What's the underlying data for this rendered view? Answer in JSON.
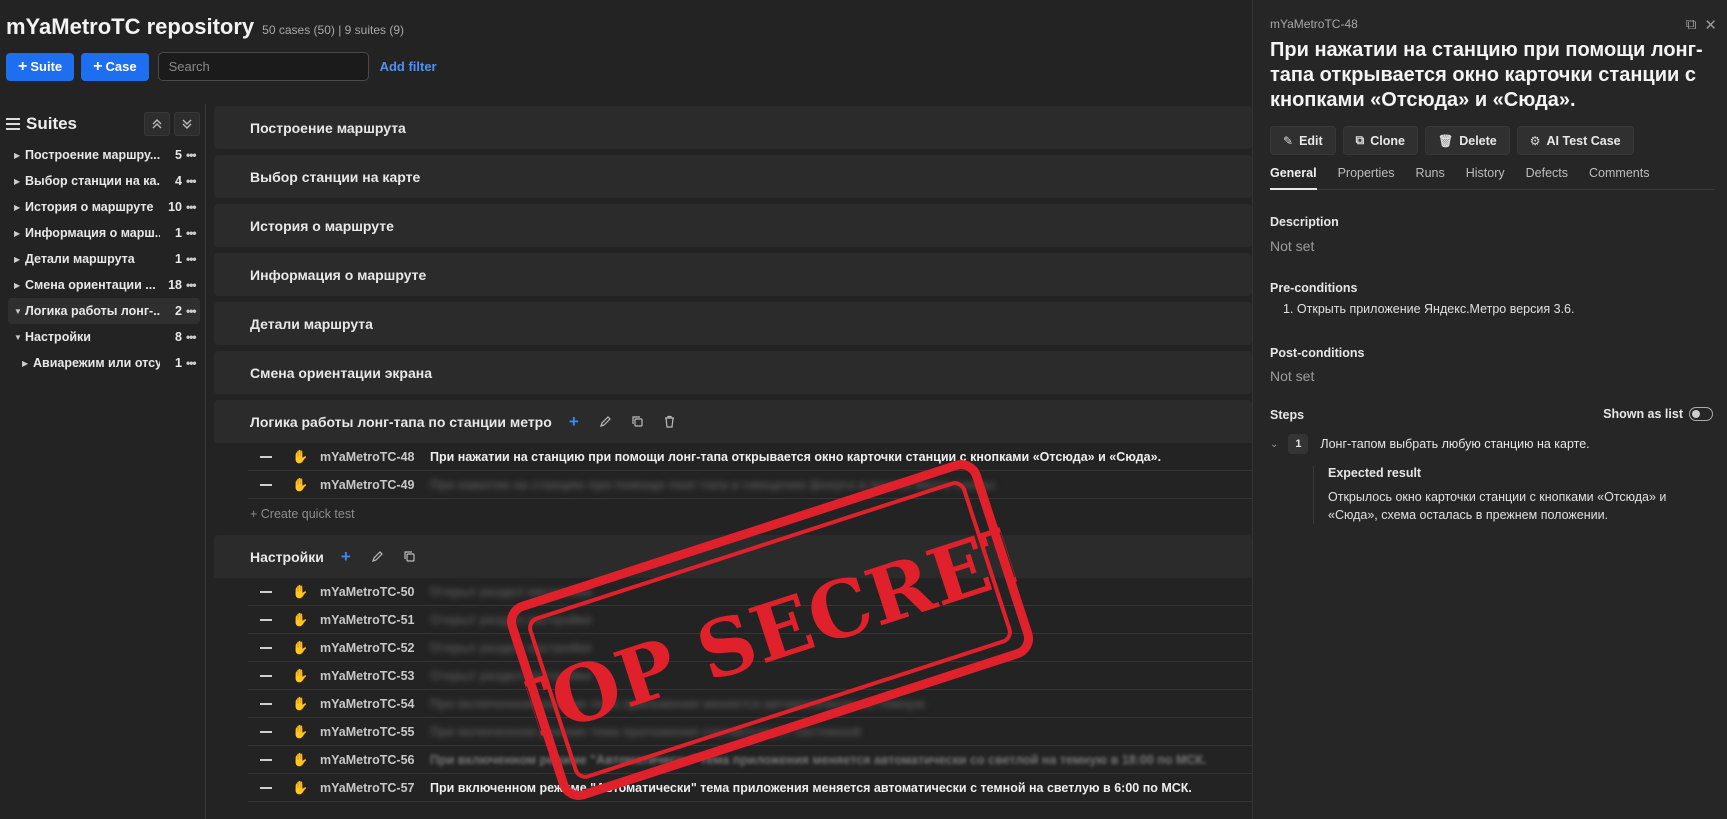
{
  "header": {
    "title": "mYaMetroTC repository",
    "meta": "50 cases (50) | 9 suites (9)",
    "suite_button": "Suite",
    "case_button": "Case",
    "search_placeholder": "Search",
    "add_filter": "Add filter"
  },
  "sidebar": {
    "title": "Suites",
    "items": [
      {
        "label": "Построение маршру...",
        "count": "5",
        "expanded": false
      },
      {
        "label": "Выбор станции на ка...",
        "count": "4",
        "expanded": false
      },
      {
        "label": "История о маршруте",
        "count": "10",
        "expanded": false
      },
      {
        "label": "Информация о марш...",
        "count": "1",
        "expanded": false
      },
      {
        "label": "Детали маршрута",
        "count": "1",
        "expanded": false
      },
      {
        "label": "Смена ориентации ...",
        "count": "18",
        "expanded": false
      },
      {
        "label": "Логика работы лонг-...",
        "count": "2",
        "expanded": true
      },
      {
        "label": "Настройки",
        "count": "8",
        "expanded": true
      },
      {
        "label": "Авиарежим или отсу...",
        "count": "1",
        "expanded": false
      }
    ]
  },
  "main": {
    "collapsed_suites": [
      "Построение маршрута",
      "Выбор станции на карте",
      "История о маршруте",
      "Информация о маршруте",
      "Детали маршрута",
      "Смена ориентации экрана"
    ],
    "longtap_suite": {
      "title": "Логика работы лонг-тапа по станции метро",
      "cases": [
        {
          "id": "mYaMetroTC-48",
          "title": "При нажатии на станцию при помощи лонг-тапа открывается окно карточки станции с кнопками «Отсюда» и «Сюда»."
        },
        {
          "id": "mYaMetroTC-49",
          "title": "При нажатии на станцию при помощи лонг-тапа и смещении фокуса в пустое место схемы"
        }
      ],
      "quick_test": "+ Create quick test"
    },
    "settings_suite": {
      "title": "Настройки",
      "cases": [
        {
          "id": "mYaMetroTC-50",
          "title": "Открыт раздел настройки"
        },
        {
          "id": "mYaMetroTC-51",
          "title": "Открыт раздел настройки"
        },
        {
          "id": "mYaMetroTC-52",
          "title": "Открыт раздел настройки"
        },
        {
          "id": "mYaMetroTC-53",
          "title": "Открыт раздел настройки"
        },
        {
          "id": "mYaMetroTC-54",
          "title": "При включенном режиме тема приложения меняется автоматически на темную"
        },
        {
          "id": "mYaMetroTC-55",
          "title": "При включенном режиме тема приложения соответствует системной"
        },
        {
          "id": "mYaMetroTC-56",
          "title": "При включенном режиме \"Автоматически\" тема приложения меняется автоматически со светлой на темную в 18:00 по МСК."
        },
        {
          "id": "mYaMetroTC-57",
          "title": "При включенном режиме \"Автоматически\" тема приложения меняется автоматически с темной на светлую в 6:00 по МСК."
        }
      ]
    }
  },
  "stamp": {
    "text": "TOP SECRET",
    "color": "#e0202a"
  },
  "panel": {
    "case_id": "mYaMetroTC-48",
    "title": "При нажатии на станцию при помощи лонг-тапа открывается окно карточки станции с кнопками «Отсюда» и «Сюда».",
    "actions": {
      "edit": "Edit",
      "clone": "Clone",
      "delete": "Delete",
      "ai": "AI Test Case"
    },
    "tabs": [
      "General",
      "Properties",
      "Runs",
      "History",
      "Defects",
      "Comments"
    ],
    "description_label": "Description",
    "description_value": "Not set",
    "preconditions_label": "Pre-conditions",
    "preconditions": "1.  Открыть приложение Яндекс.Метро версия 3.6.",
    "postconditions_label": "Post-conditions",
    "postconditions_value": "Not set",
    "steps_label": "Steps",
    "shown_as_list": "Shown as list",
    "step": {
      "num": "1",
      "text": "Лонг-тапом выбрать любую станцию на карте."
    },
    "expected_label": "Expected result",
    "expected_text": "Открылось окно карточки станции с кнопками «Отсюда» и «Сюда», схема осталась в прежнем положении."
  },
  "colors": {
    "accent": "#1e6ff0",
    "link": "#4f92f3",
    "background": "#232323"
  }
}
